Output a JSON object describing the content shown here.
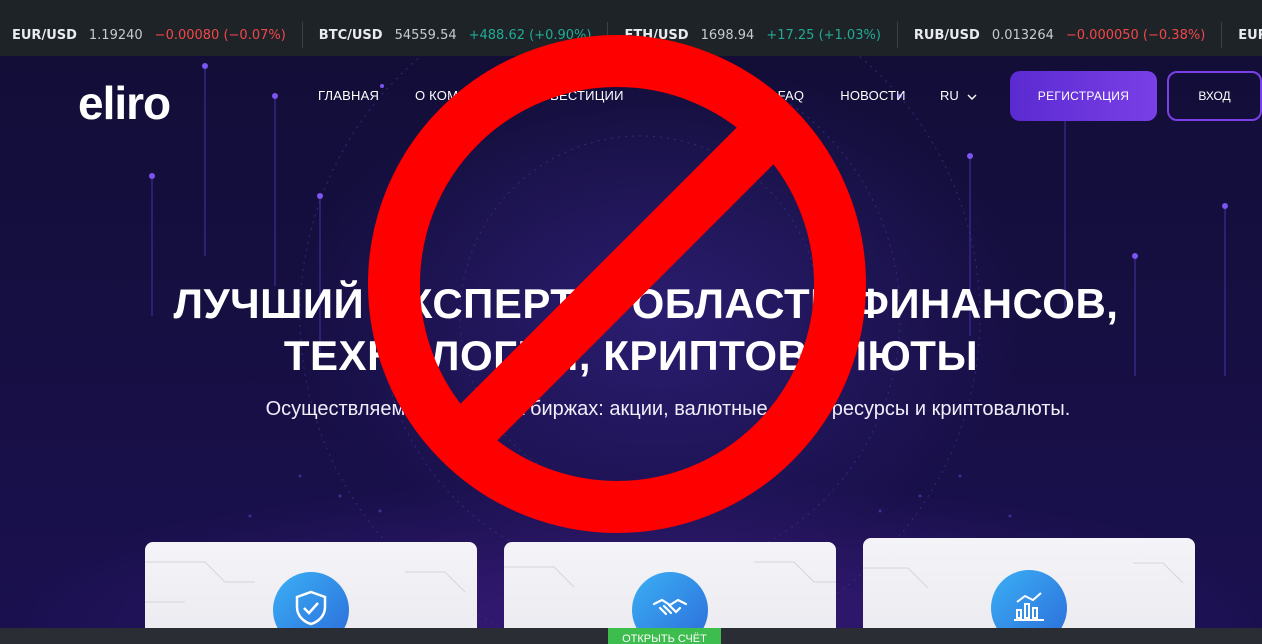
{
  "ticker": [
    {
      "symbol": "EUR/USD",
      "price": "1.19240",
      "change": "−0.00080 (−0.07%)",
      "direction": "down"
    },
    {
      "symbol": "BTC/USD",
      "price": "54559.54",
      "change": "+488.62 (+0.90%)",
      "direction": "up"
    },
    {
      "symbol": "ETH/USD",
      "price": "1698.94",
      "change": "+17.25 (+1.03%)",
      "direction": "up"
    },
    {
      "symbol": "RUB/USD",
      "price": "0.013264",
      "change": "−0.000050 (−0.38%)",
      "direction": "down"
    },
    {
      "symbol": "EUR/",
      "price": "",
      "change": "",
      "direction": "down"
    }
  ],
  "logo": {
    "text": "eliro"
  },
  "nav": {
    "items": [
      {
        "label": "ГЛАВНАЯ"
      },
      {
        "label": "О КОМ"
      },
      {
        "label": "ВЕСТИЦИИ"
      },
      {
        "label": "FAQ"
      },
      {
        "label": "НОВОСТИ"
      }
    ],
    "lang": "RU"
  },
  "buttons": {
    "register": "РЕГИСТРАЦИЯ",
    "login": "ВХОД"
  },
  "hero": {
    "headline_line1": "ЛУЧШИЙ ЭКСПЕРТ В ОБЛАСТИ ФИНАНСОВ,",
    "headline_line2": "ТЕХНОЛОГИЙ, КРИПТОВАЛЮТЫ",
    "subtitle": "Осуществляем торговлю на биржах: акции, валютные пары, ресурсы и криптовалюты."
  },
  "cards": [
    {
      "icon": "shield-check-icon"
    },
    {
      "icon": "handshake-icon"
    },
    {
      "icon": "bar-chart-icon"
    }
  ],
  "bottom_bar": {
    "open_account": "ОТКРЫТЬ СЧЁТ"
  },
  "colors": {
    "ban_red": "#ff0000",
    "accent_purple": "#7a3fe6",
    "logo_blue": "#2e8df0",
    "up": "#22ab94",
    "down": "#f2474a"
  }
}
